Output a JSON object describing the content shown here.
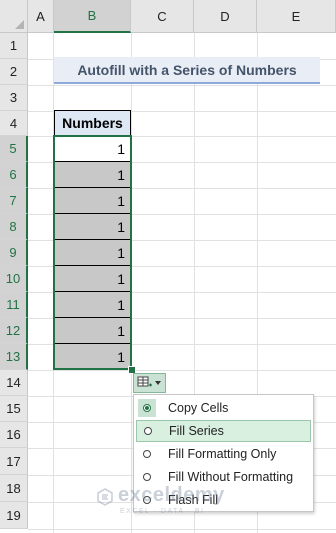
{
  "columns": [
    "A",
    "B",
    "C",
    "D",
    "E"
  ],
  "selected_column": "B",
  "rows": [
    "1",
    "2",
    "3",
    "4",
    "5",
    "6",
    "7",
    "8",
    "9",
    "10",
    "11",
    "12",
    "13",
    "14",
    "15",
    "16",
    "17",
    "18",
    "19"
  ],
  "selected_rows": [
    "5",
    "6",
    "7",
    "8",
    "9",
    "10",
    "11",
    "12",
    "13"
  ],
  "title": "Autofill with a Series of Numbers",
  "table": {
    "header": "Numbers",
    "values": [
      "1",
      "1",
      "1",
      "1",
      "1",
      "1",
      "1",
      "1",
      "1"
    ]
  },
  "autofill_button": {
    "icon": "auto-fill-options-icon"
  },
  "autofill_menu": {
    "items": [
      {
        "label": "Copy Cells",
        "selected": true
      },
      {
        "label": "Fill Series",
        "selected": false,
        "highlighted": true
      },
      {
        "label": "Fill Formatting Only",
        "selected": false
      },
      {
        "label": "Fill Without Formatting",
        "selected": false
      },
      {
        "label": "Flash Fill",
        "selected": false
      }
    ]
  },
  "watermark": {
    "name": "exceldemy",
    "tagline": "EXCEL · DATA · BI"
  },
  "colors": {
    "accent": "#217346",
    "fill_gray": "#c8c8c8",
    "title_bg": "#e9edf5",
    "header_bg": "#dde8f4"
  }
}
